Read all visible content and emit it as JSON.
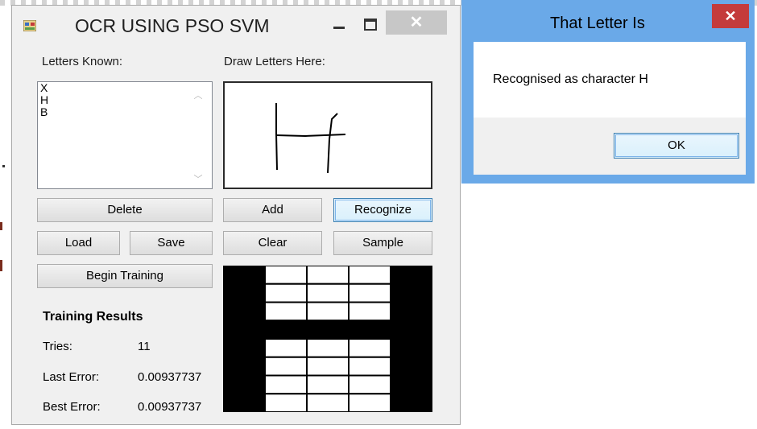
{
  "main_window": {
    "title": "OCR USING PSO SVM",
    "icons": {
      "app": "app-form-icon",
      "minimize": "minimize-icon",
      "maximize": "maximize-icon",
      "close": "close-icon"
    },
    "close_glyph": "✕",
    "letters_known_label": "Letters Known:",
    "draw_label": "Draw Letters Here:",
    "letters": [
      "X",
      "H",
      "B"
    ],
    "buttons": {
      "delete": "Delete",
      "add": "Add",
      "recognize": "Recognize",
      "load": "Load",
      "save": "Save",
      "clear": "Clear",
      "sample": "Sample",
      "begin_training": "Begin Training"
    },
    "training": {
      "title": "Training Results",
      "tries_label": "Tries:",
      "tries_value": "11",
      "last_error_label": "Last Error:",
      "last_error_value": "0.00937737",
      "best_error_label": "Best Error:",
      "best_error_value": "0.00937737"
    },
    "sample_grid": {
      "cols": 5,
      "rows": 8,
      "cells": [
        [
          1,
          0,
          0,
          0,
          1
        ],
        [
          1,
          0,
          0,
          0,
          1
        ],
        [
          1,
          0,
          0,
          0,
          1
        ],
        [
          1,
          1,
          1,
          1,
          1
        ],
        [
          1,
          0,
          0,
          0,
          1
        ],
        [
          1,
          0,
          0,
          0,
          1
        ],
        [
          1,
          0,
          0,
          0,
          1
        ],
        [
          1,
          0,
          0,
          0,
          1
        ]
      ]
    }
  },
  "dialog": {
    "title": "That Letter Is",
    "message": "Recognised as character H",
    "ok_label": "OK",
    "close_glyph": "✕",
    "title_bar_color": "#6aa9e8",
    "close_color": "#c43b3b"
  }
}
